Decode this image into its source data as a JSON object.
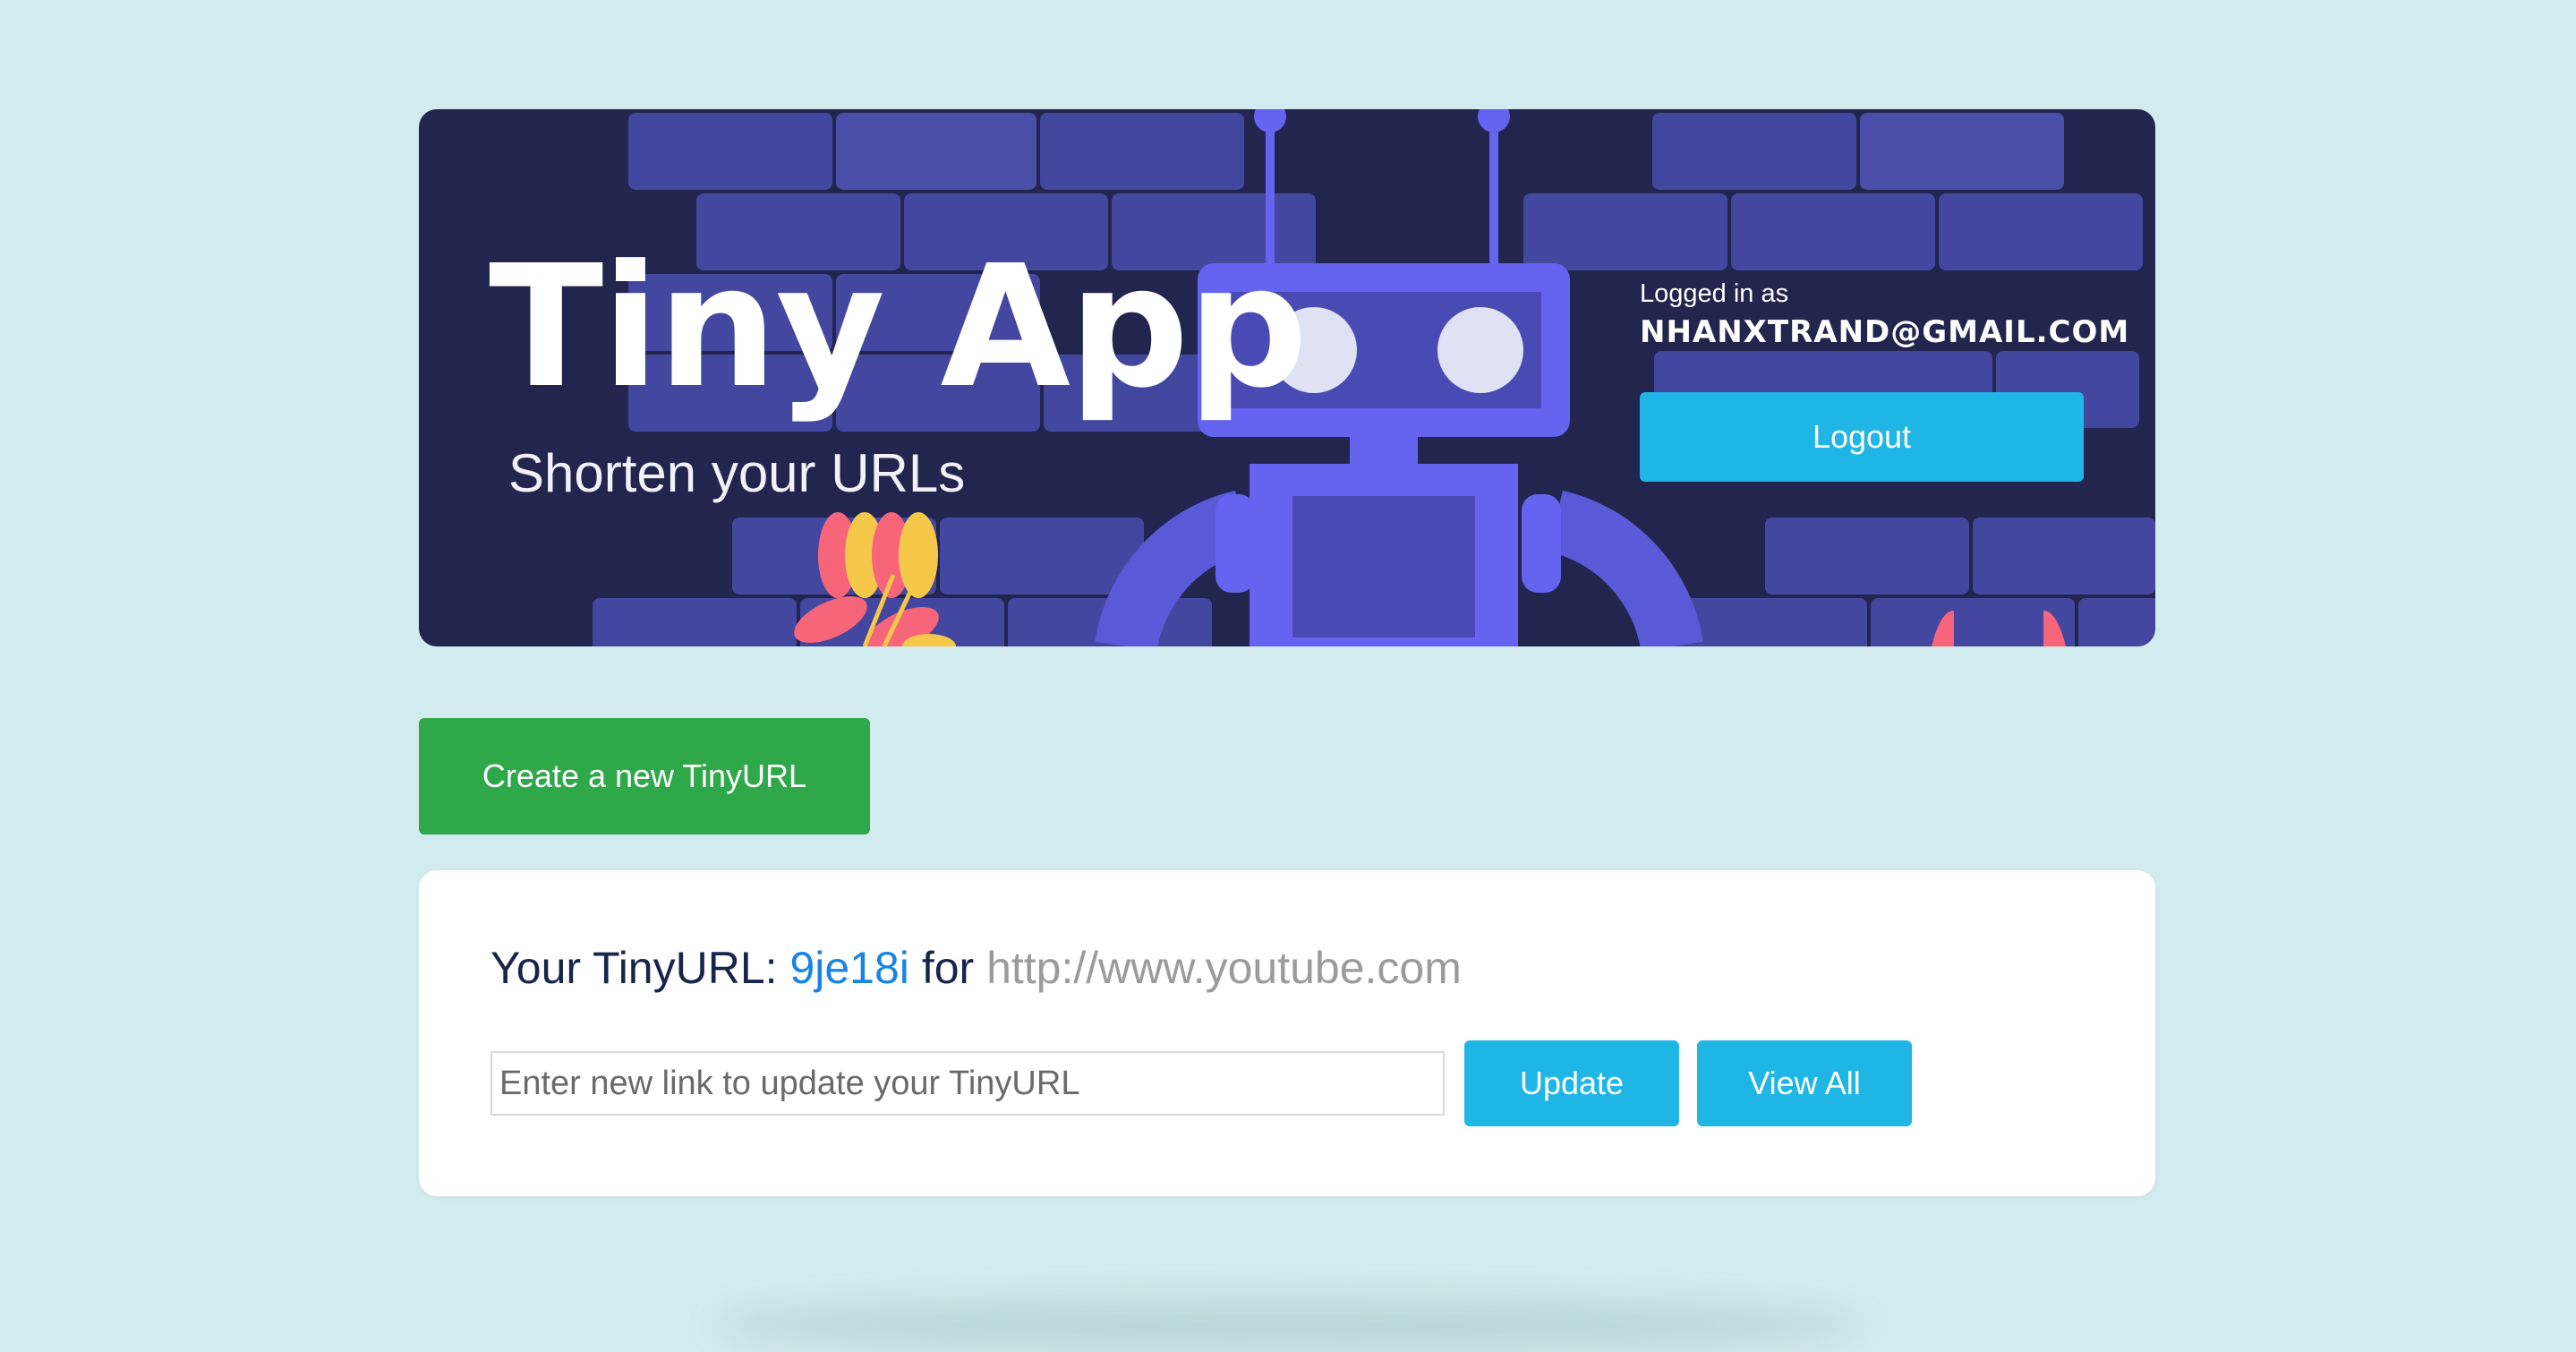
{
  "hero": {
    "title": "Tiny App",
    "subtitle": "Shorten your URLs",
    "login_label": "Logged in as",
    "user_email": "NHANXTRAND@GMAIL.COM",
    "logout_label": "Logout"
  },
  "actions": {
    "create_label": "Create a new TinyURL"
  },
  "url_card": {
    "heading_prefix": "Your TinyURL:",
    "short_code": "9je18i",
    "heading_for": "for",
    "long_url": "http://www.youtube.com",
    "input_placeholder": "Enter new link to update your TinyURL",
    "update_label": "Update",
    "view_all_label": "View All"
  },
  "colors": {
    "page_bg": "#d2ebee",
    "hero_bg": "#22254d",
    "brick": "#4347a0",
    "robot": "#6464f0",
    "primary_button": "#1fb6e6",
    "create_button": "#2fa84a",
    "link_code": "#1a84e4"
  },
  "icons": {
    "hero_illustration": "robot-illustration"
  }
}
